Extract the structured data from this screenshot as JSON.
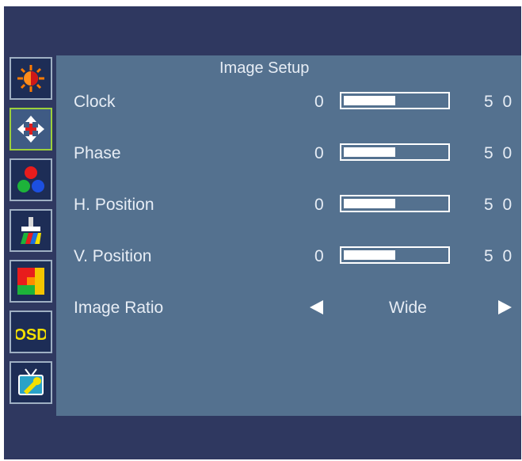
{
  "title": "Image Setup",
  "sidebar": {
    "items": [
      {
        "icon": "brightness-icon",
        "active": false
      },
      {
        "icon": "image-setup-icon",
        "active": true
      },
      {
        "icon": "color-icon",
        "active": false
      },
      {
        "icon": "brush-icon",
        "active": false
      },
      {
        "icon": "picture-boost-icon",
        "active": false
      },
      {
        "icon": "osd-icon",
        "active": false,
        "label": "OSD"
      },
      {
        "icon": "extra-settings-icon",
        "active": false
      }
    ]
  },
  "settings": [
    {
      "label": "Clock",
      "min": "0",
      "value": "5 0",
      "level": 0.5
    },
    {
      "label": "Phase",
      "min": "0",
      "value": "5 0",
      "level": 0.5
    },
    {
      "label": "H. Position",
      "min": "0",
      "value": "5 0",
      "level": 0.5
    },
    {
      "label": "V. Position",
      "min": "0",
      "value": "5 0",
      "level": 0.5
    }
  ],
  "image_ratio": {
    "label": "Image Ratio",
    "value": "Wide"
  },
  "colors": {
    "background": "#2f3860",
    "panel": "#54718f",
    "active_border": "#9ccf3b",
    "text": "#e7edf5"
  }
}
